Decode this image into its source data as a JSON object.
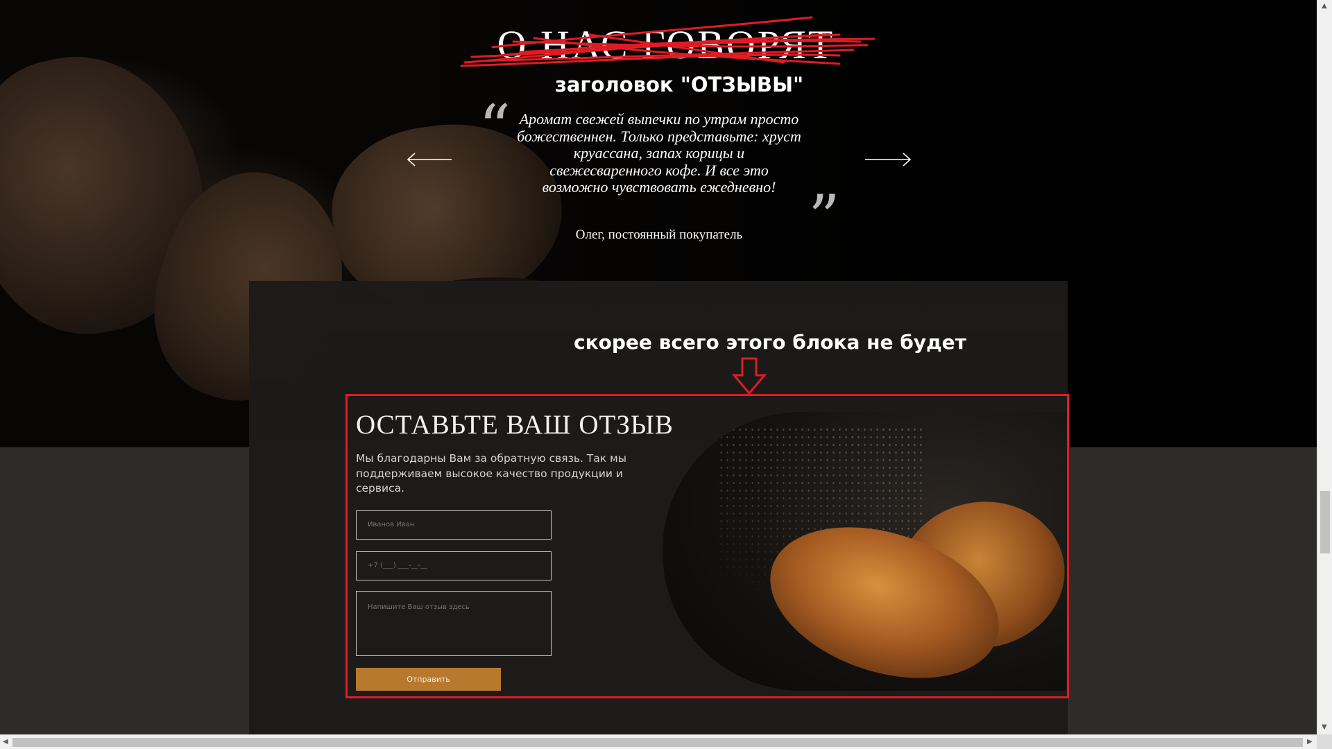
{
  "testimonials": {
    "old_title": "О НАС ГОВОРЯТ",
    "annotation_title": "заголовок \"ОТЗЫВЫ\"",
    "quote": "Аромат свежей выпечки по утрам просто божественнен. Только представьте: хруст круассана, запах корицы и свежесваренного кофе. И все это возможно чувствовать ежедневно!",
    "author": "Олег, постоянный покупатель",
    "open_quote": "“",
    "close_quote": "”"
  },
  "annotation_block": "скорее всего этого блока не будет",
  "review_form": {
    "title": "ОСТАВЬТЕ ВАШ ОТЗЫВ",
    "description": "Мы благодарны Вам за обратную связь. Так мы поддерживаем высокое качество продукции и сервиса.",
    "name_placeholder": "Иванов Иван",
    "phone_placeholder": "+7 (___) ___-__-__",
    "review_placeholder": "Напишите Ваш отзыв здесь",
    "submit_label": "Отправить"
  },
  "colors": {
    "accent": "#b8792f",
    "annotation_red": "#e01b24",
    "panel": "#1c1b19"
  },
  "icons": [
    "arrow-left-icon",
    "arrow-right-icon",
    "down-arrow-icon"
  ],
  "scrollbar": {
    "up": "▲",
    "down": "▼",
    "left": "◀",
    "right": "▶"
  }
}
